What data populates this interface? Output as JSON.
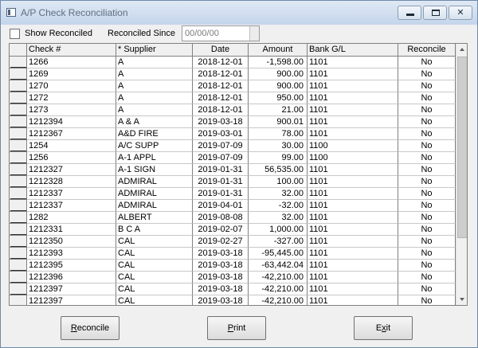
{
  "window": {
    "title": "A/P Check Reconciliation"
  },
  "filters": {
    "show_reconciled_label": "Show Reconciled",
    "reconciled_since_label": "Reconciled Since",
    "reconciled_since_value": "00/00/00"
  },
  "table": {
    "columns": [
      "Check #",
      "* Supplier",
      "Date",
      "Amount",
      "Bank G/L",
      "Reconcile"
    ],
    "rows": [
      [
        "1266",
        "A",
        "2018-12-01",
        "-1,598.00",
        "1101",
        "No"
      ],
      [
        "1269",
        "A",
        "2018-12-01",
        "900.00",
        "1101",
        "No"
      ],
      [
        "1270",
        "A",
        "2018-12-01",
        "900.00",
        "1101",
        "No"
      ],
      [
        "1272",
        "A",
        "2018-12-01",
        "950.00",
        "1101",
        "No"
      ],
      [
        "1273",
        "A",
        "2018-12-01",
        "21.00",
        "1101",
        "No"
      ],
      [
        "1212394",
        "A & A",
        "2019-03-18",
        "900.01",
        "1101",
        "No"
      ],
      [
        "1212367",
        "A&D FIRE",
        "2019-03-01",
        "78.00",
        "1101",
        "No"
      ],
      [
        "1254",
        "A/C SUPP",
        "2019-07-09",
        "30.00",
        "1100",
        "No"
      ],
      [
        "1256",
        "A-1 APPL",
        "2019-07-09",
        "99.00",
        "1100",
        "No"
      ],
      [
        "1212327",
        "A-1 SIGN",
        "2019-01-31",
        "56,535.00",
        "1101",
        "No"
      ],
      [
        "1212328",
        "ADMIRAL",
        "2019-01-31",
        "100.00",
        "1101",
        "No"
      ],
      [
        "1212337",
        "ADMIRAL",
        "2019-01-31",
        "32.00",
        "1101",
        "No"
      ],
      [
        "1212337",
        "ADMIRAL",
        "2019-04-01",
        "-32.00",
        "1101",
        "No"
      ],
      [
        "1282",
        "ALBERT",
        "2019-08-08",
        "32.00",
        "1101",
        "No"
      ],
      [
        "1212331",
        "B C A",
        "2019-02-07",
        "1,000.00",
        "1101",
        "No"
      ],
      [
        "1212350",
        "CAL",
        "2019-02-27",
        "-327.00",
        "1101",
        "No"
      ],
      [
        "1212393",
        "CAL",
        "2019-03-18",
        "-95,445.00",
        "1101",
        "No"
      ],
      [
        "1212395",
        "CAL",
        "2019-03-18",
        "-63,442.04",
        "1101",
        "No"
      ],
      [
        "1212396",
        "CAL",
        "2019-03-18",
        "-42,210.00",
        "1101",
        "No"
      ],
      [
        "1212397",
        "CAL",
        "2019-03-18",
        "-42,210.00",
        "1101",
        "No"
      ],
      [
        "1212397",
        "CAL",
        "2019-03-18",
        "-42,210.00",
        "1101",
        "No"
      ]
    ]
  },
  "buttons": {
    "reconcile": {
      "accel": "R",
      "rest": "econcile"
    },
    "print": {
      "accel": "P",
      "rest": "rint"
    },
    "exit": {
      "pre": "E",
      "accel": "x",
      "rest": "it"
    }
  }
}
